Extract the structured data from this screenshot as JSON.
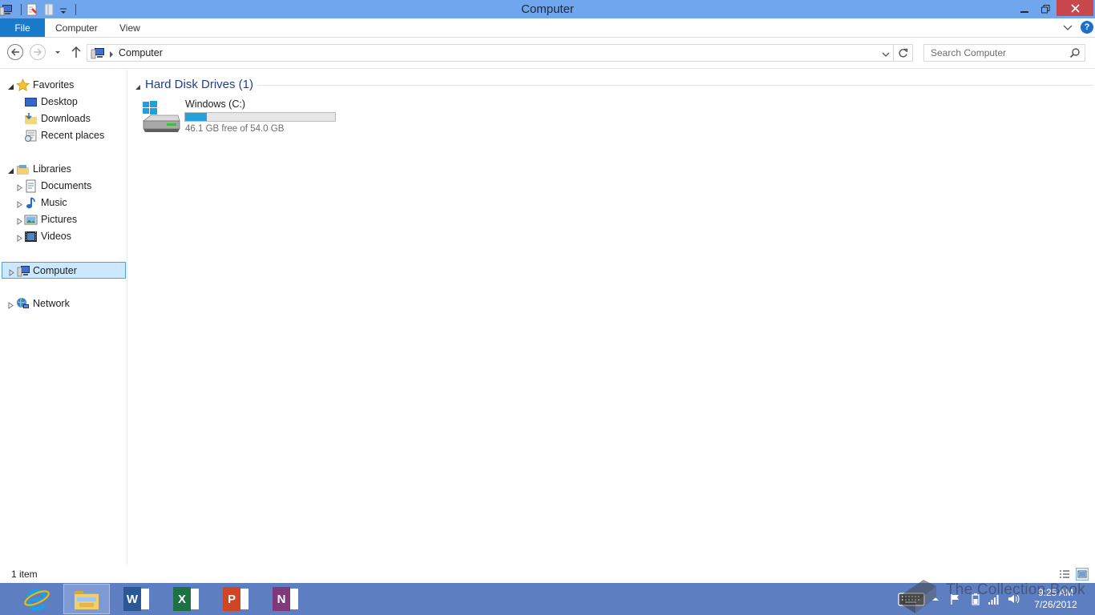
{
  "window": {
    "title": "Computer"
  },
  "ribbon": {
    "tabs": [
      "File",
      "Computer",
      "View"
    ],
    "help_label": "?"
  },
  "navigation": {
    "breadcrumb": "Computer",
    "search_placeholder": "Search Computer"
  },
  "sidebar": {
    "favorites": {
      "label": "Favorites",
      "items": [
        "Desktop",
        "Downloads",
        "Recent places"
      ]
    },
    "libraries": {
      "label": "Libraries",
      "items": [
        "Documents",
        "Music",
        "Pictures",
        "Videos"
      ]
    },
    "computer_label": "Computer",
    "network_label": "Network"
  },
  "content": {
    "group_title": "Hard Disk Drives (1)",
    "drives": [
      {
        "name": "Windows (C:)",
        "free_text": "46.1 GB free of 54.0 GB",
        "used_fraction": 0.146
      }
    ]
  },
  "status": {
    "item_count": "1 item"
  },
  "taskbar": {
    "apps": [
      "internet-explorer",
      "file-explorer",
      "word",
      "excel",
      "powerpoint",
      "onenote"
    ],
    "word_letter": "W",
    "excel_letter": "X",
    "powerpoint_letter": "P",
    "onenote_letter": "N",
    "clock_time": "9:25 AM",
    "clock_date": "7/26/2012"
  },
  "watermark": {
    "text": "The Collection Book"
  },
  "colors": {
    "titlebar": "#6fa6ee",
    "file_tab": "#1979ca",
    "close_button": "#c7474c",
    "selection": "#cce8ff",
    "progress_fill": "#26a0da",
    "group_title": "#1e3f8a",
    "taskbar": "#5d7fc1",
    "word": "#2b5797",
    "excel": "#1e7145",
    "powerpoint": "#d04525",
    "onenote": "#80397b"
  }
}
